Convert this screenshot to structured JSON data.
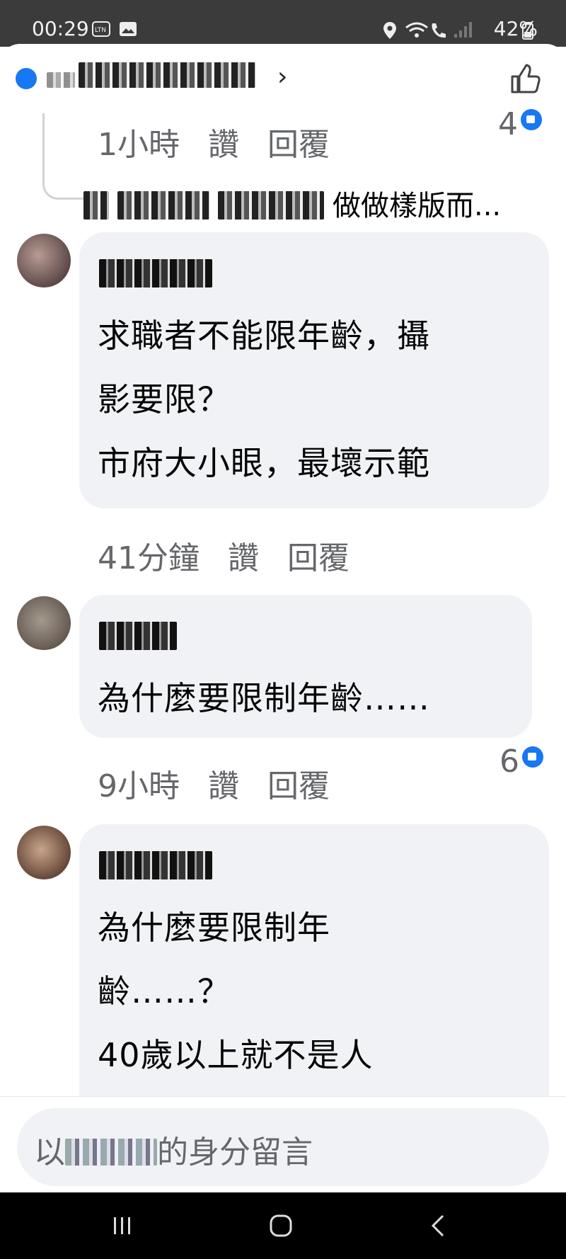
{
  "status": {
    "time": "00:29",
    "battery": "42%"
  },
  "header": {
    "name_text": "",
    "chevron": "›"
  },
  "comments": [
    {
      "meta": {
        "time": "1小時",
        "like": "讚",
        "reply": "回覆"
      },
      "reactions": "4",
      "reply_preview": {
        "text": "做做樣版而..."
      }
    },
    {
      "lines": [
        "求職者不能限年齡，攝",
        "影要限？",
        "市府大小眼，最壞示範"
      ],
      "meta": {
        "time": "41分鐘",
        "like": "讚",
        "reply": "回覆"
      }
    },
    {
      "lines": [
        "為什麼要限制年齡……"
      ],
      "meta": {
        "time": "9小時",
        "like": "讚",
        "reply": "回覆"
      },
      "reactions": "6"
    },
    {
      "lines": [
        "為什麼要限制年",
        "齡……？",
        "40歲以上就不是人"
      ]
    }
  ],
  "composer": {
    "prefix": "以",
    "suffix": "的身分留言"
  },
  "colors": {
    "accent": "#1877f2",
    "bubble": "#f0f2f5",
    "meta": "#65676b"
  },
  "icons": [
    "location-icon",
    "wifi-icon",
    "wifi-call-icon",
    "signal-icon",
    "battery-icon",
    "like-icon",
    "thumbs-up-icon",
    "recent-apps-icon",
    "home-icon",
    "back-icon"
  ]
}
